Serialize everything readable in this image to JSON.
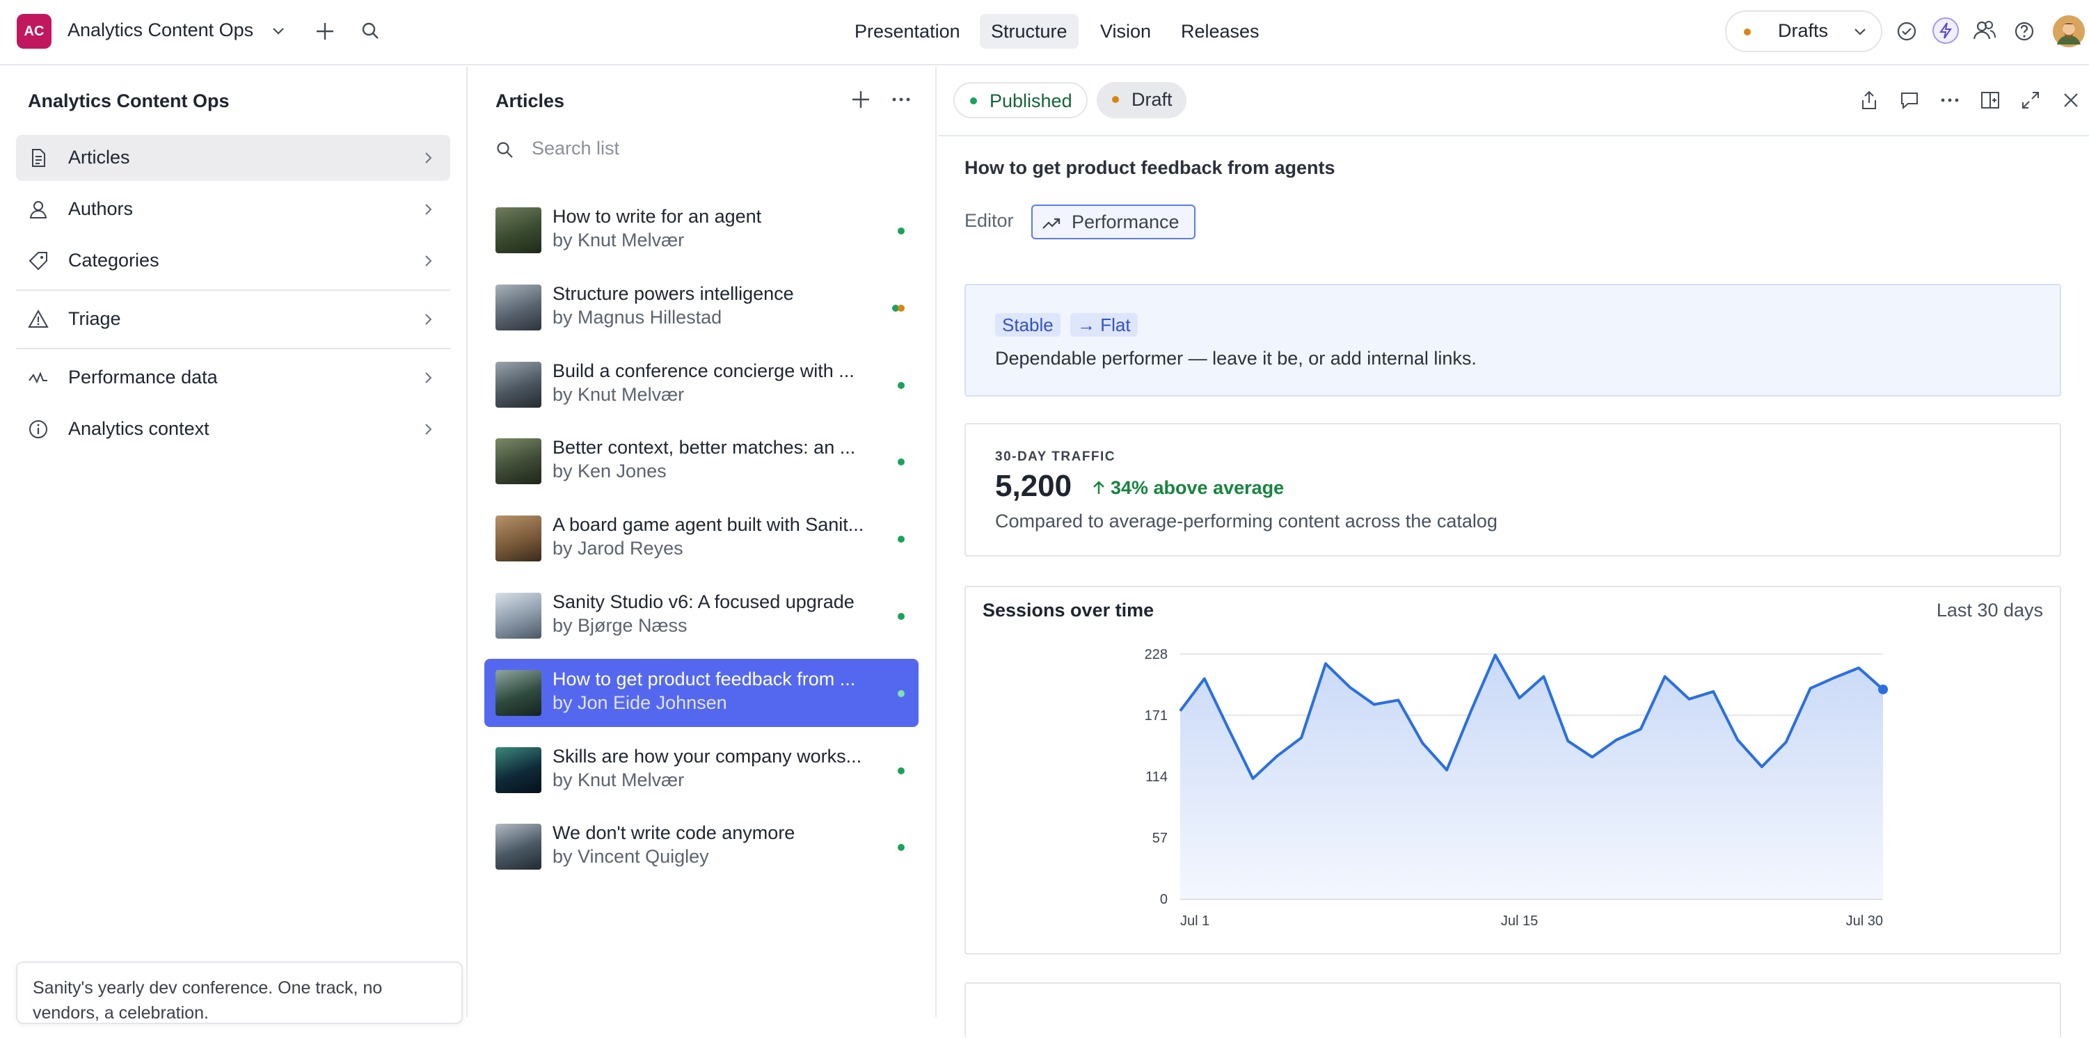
{
  "topbar": {
    "workspace_badge": "AC",
    "workspace_title": "Analytics Content Ops",
    "nav_tabs": [
      {
        "label": "Presentation",
        "active": false
      },
      {
        "label": "Structure",
        "active": true
      },
      {
        "label": "Vision",
        "active": false
      },
      {
        "label": "Releases",
        "active": false
      }
    ],
    "perspective": "Drafts",
    "perspective_dot_color": "#d9860f",
    "icons": [
      "plus-icon",
      "search-icon",
      "checkmark-circle-icon",
      "lightning-icon",
      "users-icon",
      "help-icon",
      "avatar"
    ]
  },
  "left_pane": {
    "title": "Analytics Content Ops",
    "items": [
      {
        "label": "Articles",
        "icon": "document-icon",
        "active": true
      },
      {
        "label": "Authors",
        "icon": "user-icon",
        "active": false
      },
      {
        "label": "Categories",
        "icon": "tag-icon",
        "active": false
      },
      {
        "label": "Triage",
        "icon": "warning-icon",
        "active": false
      },
      {
        "label": "Performance data",
        "icon": "activity-icon",
        "active": false
      },
      {
        "label": "Analytics context",
        "icon": "info-icon",
        "active": false
      }
    ],
    "toast_text": "Sanity's yearly dev conference. One track, no vendors, a celebration."
  },
  "middle_pane": {
    "title": "Articles",
    "search_placeholder": "Search list",
    "documents": [
      {
        "title": "How to write for an agent",
        "author": "by Knut Melvær",
        "status": [
          "published"
        ],
        "selected": false
      },
      {
        "title": "Structure powers intelligence",
        "author": "by Magnus Hillestad",
        "status": [
          "published",
          "draft"
        ],
        "selected": false
      },
      {
        "title": "Build a conference concierge with ...",
        "author": "by Knut Melvær",
        "status": [
          "published"
        ],
        "selected": false
      },
      {
        "title": "Better context, better matches: an ...",
        "author": "by Ken Jones",
        "status": [
          "published"
        ],
        "selected": false
      },
      {
        "title": "A board game agent built with Sanit...",
        "author": "by Jarod Reyes",
        "status": [
          "published"
        ],
        "selected": false
      },
      {
        "title": "Sanity Studio v6: A focused upgrade",
        "author": "by Bjørge Næss",
        "status": [
          "published"
        ],
        "selected": false
      },
      {
        "title": "How to get product feedback from ...",
        "author": "by Jon Eide Johnsen",
        "status": [
          "published"
        ],
        "selected": true
      },
      {
        "title": "Skills are how your company works...",
        "author": "by Knut Melvær",
        "status": [
          "published"
        ],
        "selected": false
      },
      {
        "title": "We don't write code anymore",
        "author": "by Vincent Quigley",
        "status": [
          "published"
        ],
        "selected": false
      }
    ]
  },
  "document": {
    "pills": [
      {
        "label": "Published",
        "dot_color": "#1aa35a"
      },
      {
        "label": "Draft",
        "dot_color": "#d9860f"
      }
    ],
    "title": "How to get product feedback from agents",
    "tabs": {
      "editor": "Editor",
      "performance": "Performance"
    },
    "insight": {
      "tags": [
        "Stable",
        "→ Flat"
      ],
      "text": "Dependable performer — leave it be, or add internal links."
    },
    "traffic": {
      "label": "30-DAY TRAFFIC",
      "value": "5,200",
      "delta": "34% above average",
      "note": "Compared to average-performing content across the catalog"
    },
    "sessions_chart": {
      "title": "Sessions over time",
      "range": "Last 30 days"
    }
  },
  "colors": {
    "accent": "#5468ef",
    "published": "#1aa35a",
    "draft": "#d9860f",
    "chart_line": "#2a6fe0",
    "badge": "#c0175f"
  },
  "chart_data": {
    "type": "area",
    "title": "Sessions over time",
    "x_tick_labels": [
      "Jul 1",
      "Jul 15",
      "Jul 30"
    ],
    "x": [
      1,
      2,
      3,
      4,
      5,
      6,
      7,
      8,
      9,
      10,
      11,
      12,
      13,
      14,
      15,
      16,
      17,
      18,
      19,
      20,
      21,
      22,
      23,
      24,
      25,
      26,
      27,
      28,
      29,
      30
    ],
    "values": [
      175,
      205,
      158,
      112,
      133,
      150,
      219,
      197,
      181,
      185,
      145,
      120,
      175,
      227,
      187,
      207,
      147,
      132,
      148,
      158,
      207,
      186,
      193,
      148,
      123,
      146,
      196,
      206,
      215,
      195
    ],
    "y_ticks": [
      0,
      57,
      114,
      171,
      228
    ],
    "ylim": [
      0,
      228
    ],
    "grid": true,
    "legend": "none"
  }
}
